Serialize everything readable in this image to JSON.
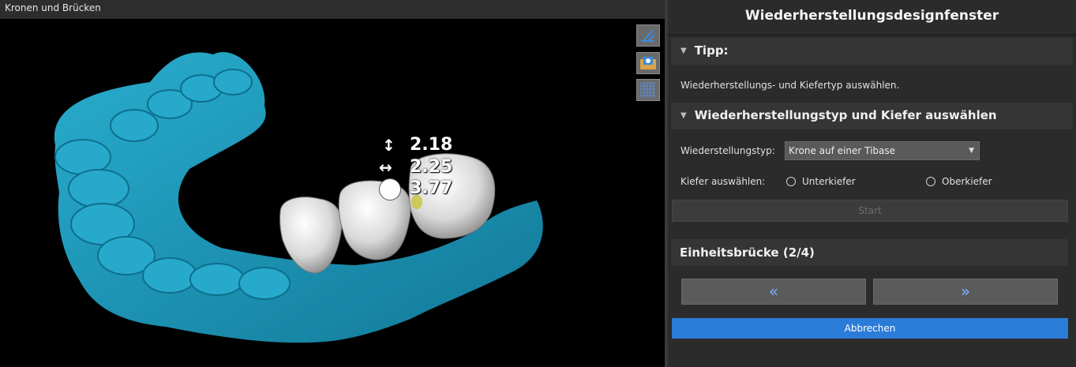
{
  "viewport": {
    "title": "Kronen und Brücken",
    "measurements": {
      "height": "2.18",
      "width": "2.25",
      "diameter": "3.77"
    },
    "toolbar_icons": [
      "measure-tool-icon",
      "camera-view-icon",
      "grid-icon"
    ]
  },
  "panel": {
    "title": "Wiederherstellungsdesignfenster",
    "tip": {
      "header": "Tipp:",
      "text": "Wiederherstellungs- und Kiefertyp auswählen."
    },
    "selection": {
      "header": "Wiederherstellungstyp und Kiefer auswählen",
      "type_label": "Wiederstellungstyp:",
      "type_value": "Krone auf einer Tibase",
      "jaw_label": "Kiefer auswählen:",
      "jaw_options": [
        "Unterkiefer",
        "Oberkiefer"
      ],
      "start_label": "Start"
    },
    "unit": {
      "header": "Einheitsbrücke (2/4)",
      "prev_label": "«",
      "next_label": "»"
    },
    "cancel_label": "Abbrechen"
  },
  "colors": {
    "model": "#1fa6c8",
    "accent_button": "#2b7cd8",
    "panel_bg": "#2b2b2b"
  }
}
